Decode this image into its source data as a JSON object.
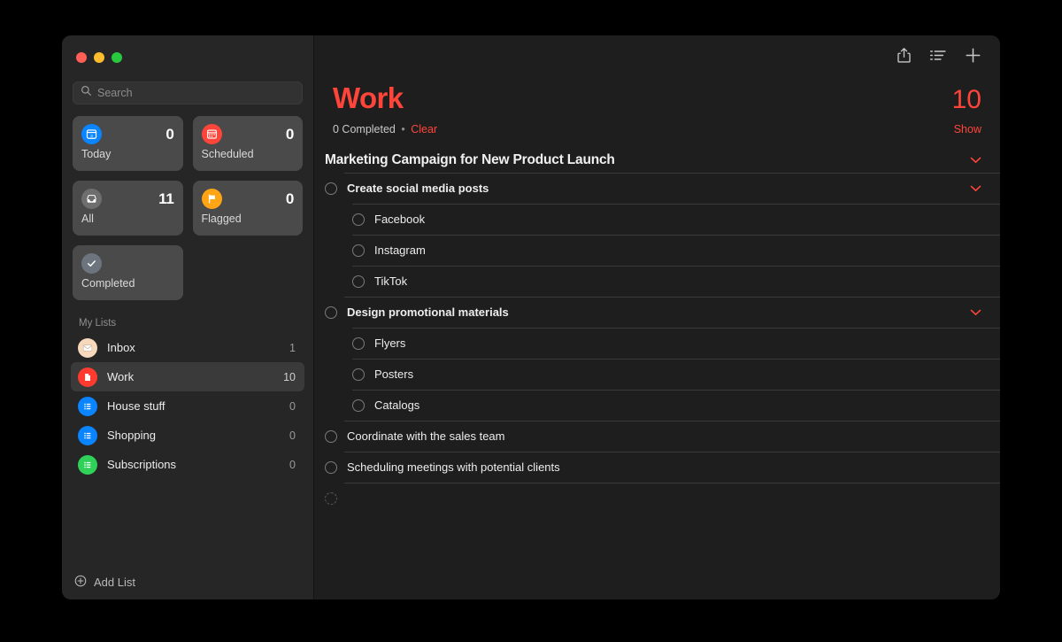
{
  "window": {
    "traffic_lights": [
      "close",
      "minimize",
      "zoom"
    ]
  },
  "sidebar": {
    "search": {
      "placeholder": "Search",
      "value": ""
    },
    "smart_cards": [
      {
        "label": "Today",
        "count": "0",
        "icon": "calendar-day-icon",
        "color": "#0a84ff"
      },
      {
        "label": "Scheduled",
        "count": "0",
        "icon": "calendar-icon",
        "color": "#ff453a"
      },
      {
        "label": "All",
        "count": "11",
        "icon": "inbox-tray-icon",
        "color": "#6e6e6e"
      },
      {
        "label": "Flagged",
        "count": "0",
        "icon": "flag-icon",
        "color": "#ffa515"
      },
      {
        "label": "Completed",
        "count": "",
        "icon": "checkmark-icon",
        "color": "#6c757d"
      }
    ],
    "my_lists_header": "My Lists",
    "lists": [
      {
        "name": "Inbox",
        "count": "1",
        "icon": "envelope-icon",
        "color": "#f6d9bd",
        "selected": false
      },
      {
        "name": "Work",
        "count": "10",
        "icon": "document-icon",
        "color": "#ff3b30",
        "selected": true
      },
      {
        "name": "House stuff",
        "count": "0",
        "icon": "list-icon",
        "color": "#0a84ff",
        "selected": false
      },
      {
        "name": "Shopping",
        "count": "0",
        "icon": "list-icon",
        "color": "#0a84ff",
        "selected": false
      },
      {
        "name": "Subscriptions",
        "count": "0",
        "icon": "list-icon",
        "color": "#30d158",
        "selected": false
      }
    ],
    "add_list_label": "Add List"
  },
  "main": {
    "toolbar": {
      "share_icon": "share-icon",
      "sort_icon": "list-sort-icon",
      "add_icon": "plus-icon"
    },
    "title": "Work",
    "total_count": "10",
    "completed_text": "0 Completed",
    "separator": "•",
    "clear_label": "Clear",
    "show_label": "Show",
    "group": {
      "title": "Marketing Campaign for New Product Launch",
      "chevron": "chevron-down-icon"
    },
    "tasks": [
      {
        "label": "Create social media posts",
        "level": 0,
        "bold": true,
        "chevron": true,
        "placeholder": false
      },
      {
        "label": "Facebook",
        "level": 1,
        "bold": false,
        "chevron": false,
        "placeholder": false
      },
      {
        "label": "Instagram",
        "level": 1,
        "bold": false,
        "chevron": false,
        "placeholder": false
      },
      {
        "label": "TikTok",
        "level": 1,
        "bold": false,
        "chevron": false,
        "placeholder": false
      },
      {
        "label": "Design promotional materials",
        "level": 0,
        "bold": true,
        "chevron": true,
        "placeholder": false
      },
      {
        "label": "Flyers",
        "level": 1,
        "bold": false,
        "chevron": false,
        "placeholder": false
      },
      {
        "label": "Posters",
        "level": 1,
        "bold": false,
        "chevron": false,
        "placeholder": false
      },
      {
        "label": "Catalogs",
        "level": 1,
        "bold": false,
        "chevron": false,
        "placeholder": false
      },
      {
        "label": "Coordinate with the sales team",
        "level": 0,
        "bold": false,
        "chevron": false,
        "placeholder": false
      },
      {
        "label": "Scheduling meetings with potential clients",
        "level": 0,
        "bold": false,
        "chevron": false,
        "placeholder": false
      },
      {
        "label": "",
        "level": 0,
        "bold": false,
        "chevron": false,
        "placeholder": true
      }
    ]
  },
  "colors": {
    "accent_red": "#ff453a",
    "sidebar_bg": "#262626",
    "main_bg": "#1e1e1e",
    "card_bg": "#4a4a4a"
  }
}
